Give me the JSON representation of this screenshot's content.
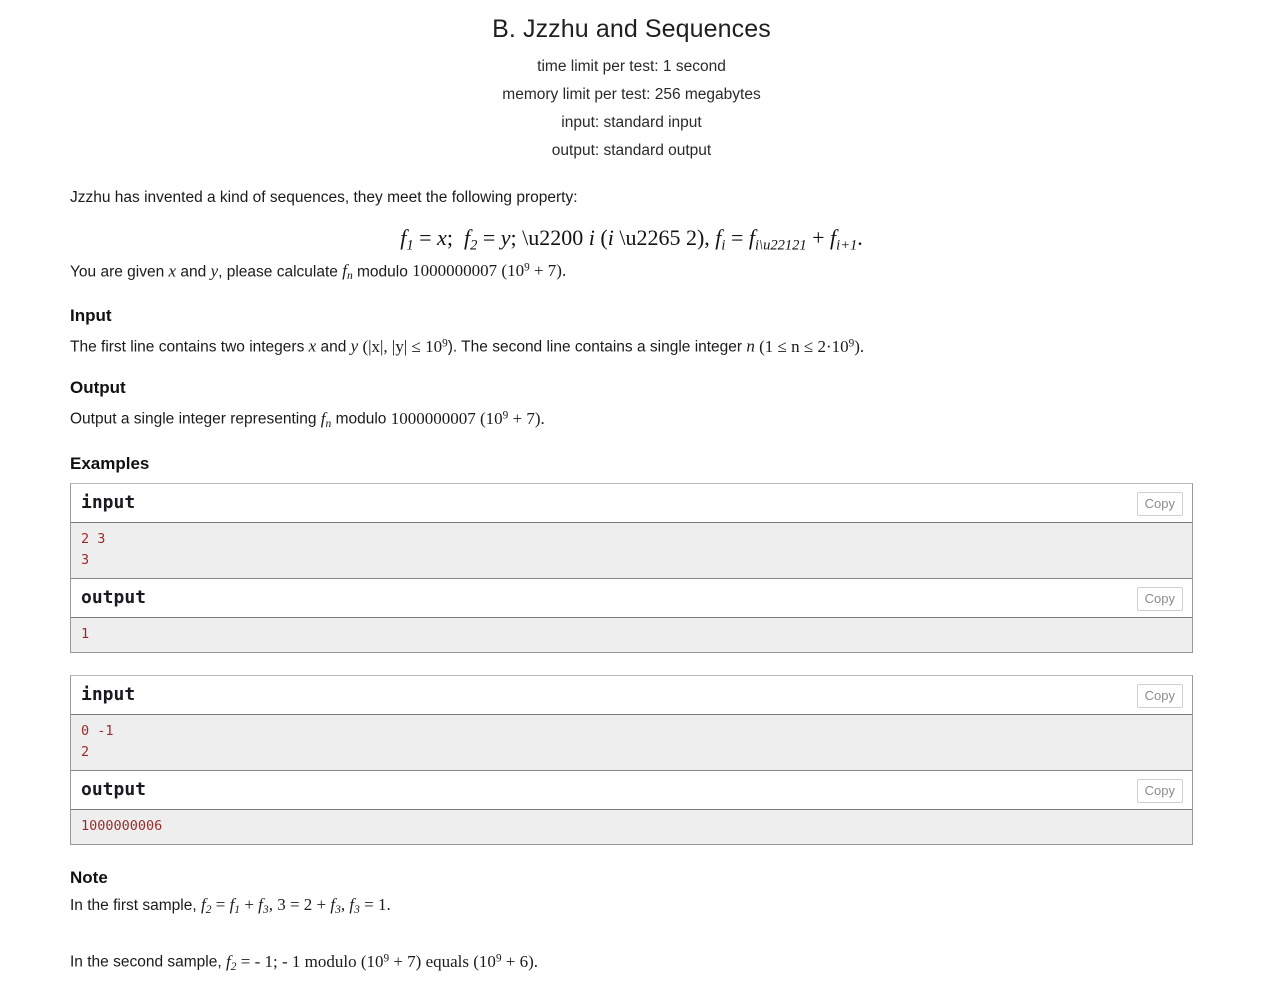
{
  "problem": {
    "title": "B. Jzzhu and Sequences",
    "limits": {
      "time": "time limit per test: 1 second",
      "memory": "memory limit per test: 256 megabytes",
      "input": "input: standard input",
      "output": "output: standard output"
    },
    "statement": {
      "intro": "Jzzhu has invented a kind of sequences, they meet the following property:",
      "display_formula": "f₁ = x;  f₂ = y; ∀ i (i ≥ 2), fᵢ = fᵢ₋₁ + fᵢ₊₁.",
      "given_prefix": "You are given ",
      "given_x": "x",
      "given_and": " and ",
      "given_y": "y",
      "given_mid": ", please calculate ",
      "given_f": "f",
      "given_f_sub": "n",
      "given_modulo": " modulo ",
      "given_mod_value": "1000000007 (10",
      "given_mod_exp": "9",
      "given_mod_tail": " + 7)."
    },
    "input_section": {
      "heading": "Input",
      "text_1": "The first line contains two integers ",
      "var_x": "x",
      "text_2": " and ",
      "var_y": "y",
      "text_3": " (|x|, |y| ≤ 10",
      "exp_1": "9",
      "text_4": "). The second line contains a single integer ",
      "var_n": "n",
      "text_5": " (1 ≤ n ≤ 2·10",
      "exp_2": "9",
      "text_6": ")."
    },
    "output_section": {
      "heading": "Output",
      "text_1": "Output a single integer representing ",
      "var_f": "f",
      "var_f_sub": "n",
      "text_2": " modulo ",
      "mod_value": "1000000007 (10",
      "exp": "9",
      "text_3": " + 7)."
    },
    "examples": {
      "heading": "Examples",
      "tests": [
        {
          "input_label": "input",
          "output_label": "output",
          "copy_label": "Copy",
          "input_text": "2 3\n3",
          "output_text": "1"
        },
        {
          "input_label": "input",
          "output_label": "output",
          "copy_label": "Copy",
          "input_text": "0 -1\n2",
          "output_text": "1000000006"
        }
      ]
    },
    "note_section": {
      "heading": "Note",
      "note_1": {
        "prefix": "In the first sample, ",
        "f2": "f",
        "f2_sub": "2",
        "eq1": " = ",
        "f1": "f",
        "f1_sub": "1",
        "plus": " + ",
        "f3a": "f",
        "f3a_sub": "3",
        "mid": ", 3 = 2 + ",
        "f3b": "f",
        "f3b_sub": "3",
        "comma": ", ",
        "f3c": "f",
        "f3c_sub": "3",
        "tail": " = 1."
      },
      "note_2": {
        "prefix": "In the second sample, ",
        "f2": "f",
        "f2_sub": "2",
        "eq": " = - 1;  - 1 modulo (10",
        "exp1": "9",
        "mid": " + 7) equals (10",
        "exp2": "9",
        "tail": " + 6)."
      }
    }
  },
  "colors": {
    "sample_bg": "#eeeeee",
    "sample_text": "#9c2b2b",
    "border": "#999999",
    "copy_text": "#8c8c8c"
  }
}
